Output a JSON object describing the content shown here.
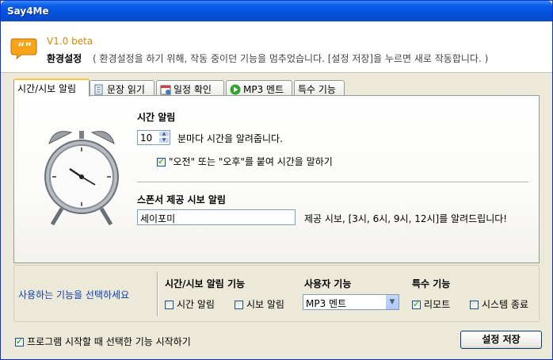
{
  "window": {
    "title": "Say4Me"
  },
  "header": {
    "version": "V1.0 beta",
    "title": "환경설정",
    "description": "( 환경설정을 하기 위해, 작동 중이던 기능을 멈추었습니다. [설정 저장]을 누르면 새로 작동합니다. )"
  },
  "tabs": [
    {
      "label": "시간/시보 알림",
      "icon": "none"
    },
    {
      "label": "문장 읽기",
      "icon": "document-icon"
    },
    {
      "label": "일정 확인",
      "icon": "calendar-icon"
    },
    {
      "label": "MP3 멘트",
      "icon": "play-icon"
    },
    {
      "label": "특수 기능",
      "icon": "none"
    }
  ],
  "time_alarm": {
    "title": "시간 알림",
    "interval_value": "10",
    "interval_suffix": "분마다 시간을 알려줍니다.",
    "ampm_label": "\"오전\" 또는 \"오후\"를 붙여 시간을 말하기",
    "ampm_checked": true
  },
  "sponsor": {
    "title": "스폰서 제공 시보 알림",
    "value": "세이포미",
    "description": "제공 시보, [3시, 6시, 9시, 12시]를 알려드립니다!"
  },
  "functions": {
    "prompt": "사용하는 기능을 선택하세요",
    "time_group": {
      "title": "시간/시보 알림 기능",
      "time_alarm_label": "시간 알림",
      "time_alarm_checked": false,
      "sibo_label": "시보 알림",
      "sibo_checked": false
    },
    "user_group": {
      "title": "사용자 기능",
      "selected": "MP3 멘트"
    },
    "special_group": {
      "title": "특수 기능",
      "remote_label": "리모트",
      "remote_checked": true,
      "shutdown_label": "시스템 종료",
      "shutdown_checked": false
    }
  },
  "footer": {
    "startup_label": "프로그램 시작할 때 선택한 기능 시작하기",
    "startup_checked": true,
    "save_label": "설정 저장"
  },
  "colors": {
    "titlebar": "#0a5ce8",
    "version": "#d88a00",
    "link": "#0b3db5",
    "tab_active_top": "#ffc83c"
  }
}
